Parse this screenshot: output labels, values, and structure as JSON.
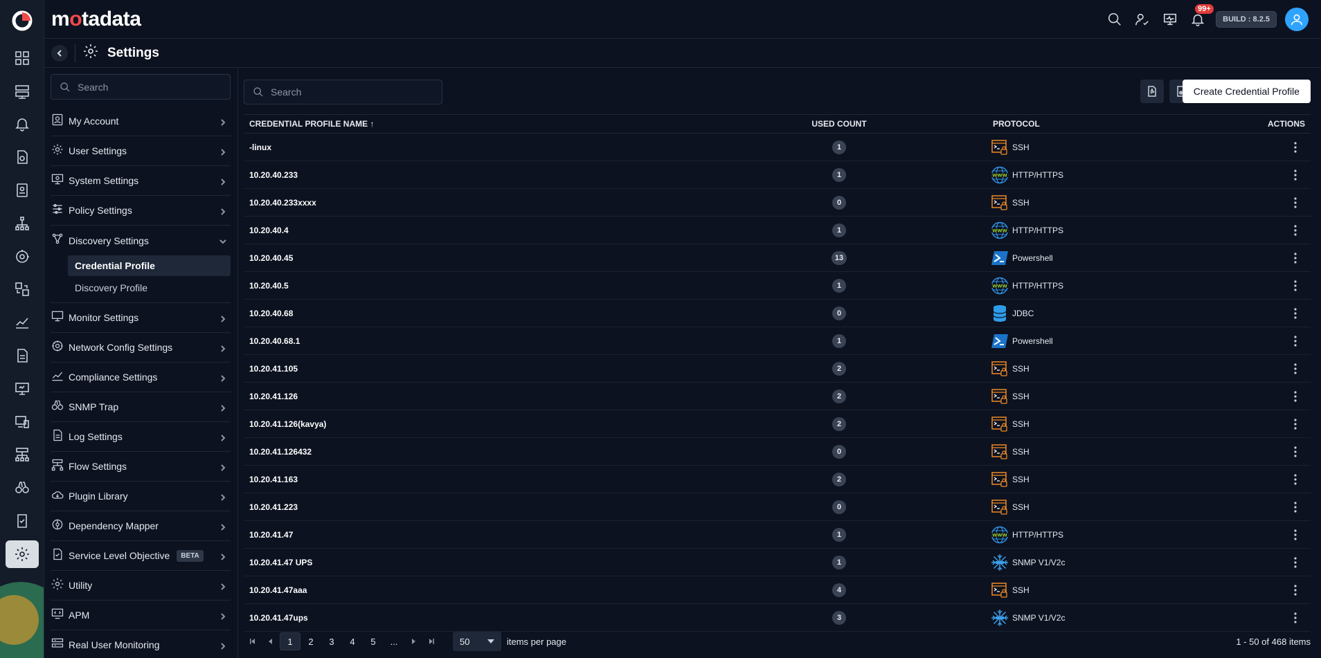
{
  "brand": {
    "pre": "m",
    "accent": "o",
    "post": "tadata"
  },
  "header": {
    "build": "BUILD : 8.2.5",
    "notification_count": "99+"
  },
  "page": {
    "title": "Settings"
  },
  "sidebar": {
    "search_placeholder": "Search",
    "items": [
      {
        "label": "My Account",
        "icon": "account-icon"
      },
      {
        "label": "User Settings",
        "icon": "user-settings-icon"
      },
      {
        "label": "System Settings",
        "icon": "system-settings-icon"
      },
      {
        "label": "Policy Settings",
        "icon": "sliders-icon"
      },
      {
        "label": "Discovery Settings",
        "icon": "discovery-icon"
      },
      {
        "label": "Monitor Settings",
        "icon": "monitor-icon"
      },
      {
        "label": "Network Config Settings",
        "icon": "network-config-icon"
      },
      {
        "label": "Compliance Settings",
        "icon": "compliance-icon"
      },
      {
        "label": "SNMP Trap",
        "icon": "binoculars-icon"
      },
      {
        "label": "Log Settings",
        "icon": "log-icon"
      },
      {
        "label": "Flow Settings",
        "icon": "flow-icon"
      },
      {
        "label": "Plugin Library",
        "icon": "plugin-icon"
      },
      {
        "label": "Dependency Mapper",
        "icon": "dependency-icon"
      },
      {
        "label": "Service Level Objective",
        "icon": "slo-icon",
        "badge": "BETA"
      },
      {
        "label": "Utility",
        "icon": "utility-icon"
      },
      {
        "label": "APM",
        "icon": "apm-icon"
      },
      {
        "label": "Real User Monitoring",
        "icon": "rum-icon"
      }
    ],
    "sub_items": [
      "Credential Profile",
      "Discovery Profile"
    ]
  },
  "toolbar": {
    "search_placeholder": "Search",
    "create_label": "Create Credential Profile"
  },
  "table": {
    "headers": {
      "name": "CREDENTIAL PROFILE NAME ↑",
      "used": "USED COUNT",
      "protocol": "PROTOCOL",
      "actions": "ACTIONS"
    },
    "rows": [
      {
        "name": "-linux",
        "used": "1",
        "protocol": "SSH"
      },
      {
        "name": "10.20.40.233",
        "used": "1",
        "protocol": "HTTP/HTTPS"
      },
      {
        "name": "10.20.40.233xxxx",
        "used": "0",
        "protocol": "SSH"
      },
      {
        "name": "10.20.40.4",
        "used": "1",
        "protocol": "HTTP/HTTPS"
      },
      {
        "name": "10.20.40.45",
        "used": "13",
        "protocol": "Powershell"
      },
      {
        "name": "10.20.40.5",
        "used": "1",
        "protocol": "HTTP/HTTPS"
      },
      {
        "name": "10.20.40.68",
        "used": "0",
        "protocol": "JDBC"
      },
      {
        "name": "10.20.40.68.1",
        "used": "1",
        "protocol": "Powershell"
      },
      {
        "name": "10.20.41.105",
        "used": "2",
        "protocol": "SSH"
      },
      {
        "name": "10.20.41.126",
        "used": "2",
        "protocol": "SSH"
      },
      {
        "name": "10.20.41.126(kavya)",
        "used": "2",
        "protocol": "SSH"
      },
      {
        "name": "10.20.41.126432",
        "used": "0",
        "protocol": "SSH"
      },
      {
        "name": "10.20.41.163",
        "used": "2",
        "protocol": "SSH"
      },
      {
        "name": "10.20.41.223",
        "used": "0",
        "protocol": "SSH"
      },
      {
        "name": "10.20.41.47",
        "used": "1",
        "protocol": "HTTP/HTTPS"
      },
      {
        "name": "10.20.41.47 UPS",
        "used": "1",
        "protocol": "SNMP V1/V2c"
      },
      {
        "name": "10.20.41.47aaa",
        "used": "4",
        "protocol": "SSH"
      },
      {
        "name": "10.20.41.47ups",
        "used": "3",
        "protocol": "SNMP V1/V2c"
      }
    ]
  },
  "pager": {
    "pages": [
      "1",
      "2",
      "3",
      "4",
      "5",
      "..."
    ],
    "current": "1",
    "page_size": "50",
    "per_page_label": "items per page",
    "total": "1 - 50 of 468 items"
  },
  "colors": {
    "accent": "#ef4a4a",
    "ssh": "#f08a24",
    "http": "#2f8fe0",
    "powershell": "#1a73c8",
    "jdbc": "#2f9be8",
    "snmp": "#3b9ee8"
  }
}
